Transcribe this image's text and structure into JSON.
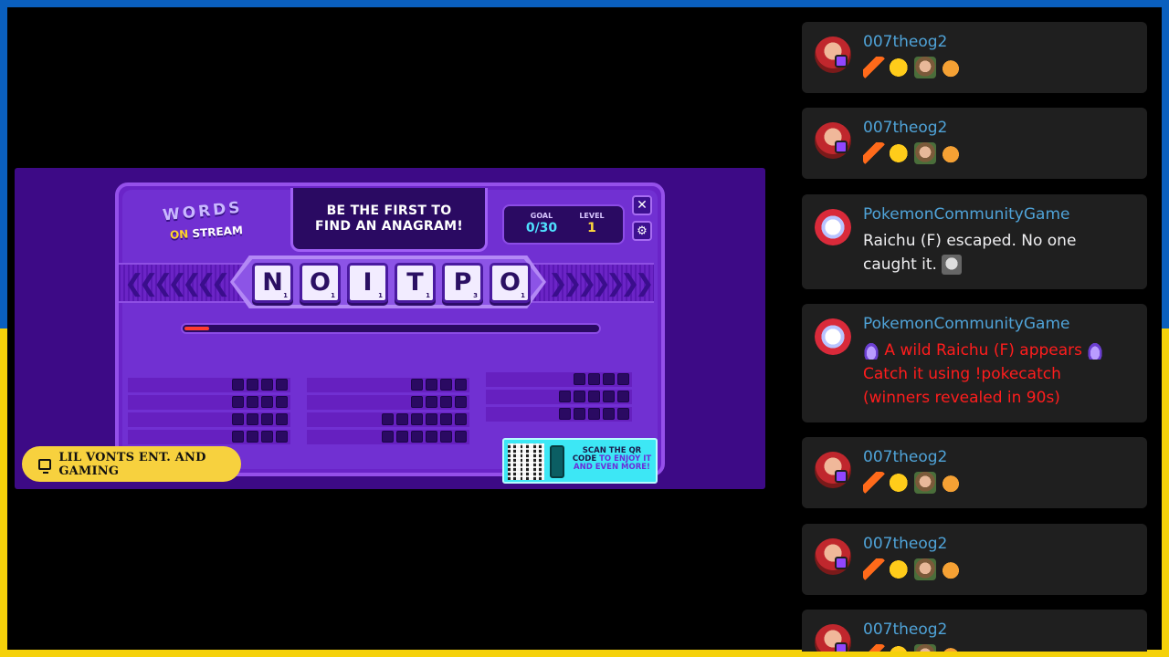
{
  "game": {
    "prompt": "BE THE FIRST TO FIND AN ANAGRAM!",
    "logo_top": "WORDS",
    "logo_on": "ON",
    "logo_stream": "STREAM",
    "goal_label": "GOAL",
    "goal_value": "0/30",
    "level_label": "LEVEL",
    "level_value": "1",
    "close_icon": "✕",
    "settings_icon": "⚙",
    "tiles": [
      {
        "letter": "N",
        "points": "1"
      },
      {
        "letter": "O",
        "points": "1"
      },
      {
        "letter": "I",
        "points": "1"
      },
      {
        "letter": "T",
        "points": "1"
      },
      {
        "letter": "P",
        "points": "3"
      },
      {
        "letter": "O",
        "points": "1"
      }
    ],
    "progress_fraction": 0.06,
    "qr_text_1": "SCAN THE QR",
    "qr_text_2": "CODE",
    "qr_text_3": "TO ENJOY IT",
    "qr_text_4": "AND EVEN MORE!"
  },
  "channel": {
    "name": "LIL VONTS ENT. AND GAMING"
  },
  "chat": {
    "messages": [
      {
        "user": "007theog2",
        "type": "emotes"
      },
      {
        "user": "007theog2",
        "type": "emotes"
      },
      {
        "user": "PokemonCommunityGame",
        "text": "Raichu (F) escaped. No one caught it."
      },
      {
        "user": "PokemonCommunityGame",
        "text": "A wild Raichu (F) appears",
        "text2": "Catch it using !pokecatch (winners revealed in 90s)"
      },
      {
        "user": "007theog2",
        "type": "emotes"
      },
      {
        "user": "007theog2",
        "type": "emotes"
      },
      {
        "user": "007theog2",
        "type": "emotes"
      }
    ]
  },
  "colors": {
    "username": "#4fa3d8",
    "alert": "#ff1d1d",
    "flag_blue": "#0a5fbe",
    "flag_yellow": "#f5d10a"
  }
}
